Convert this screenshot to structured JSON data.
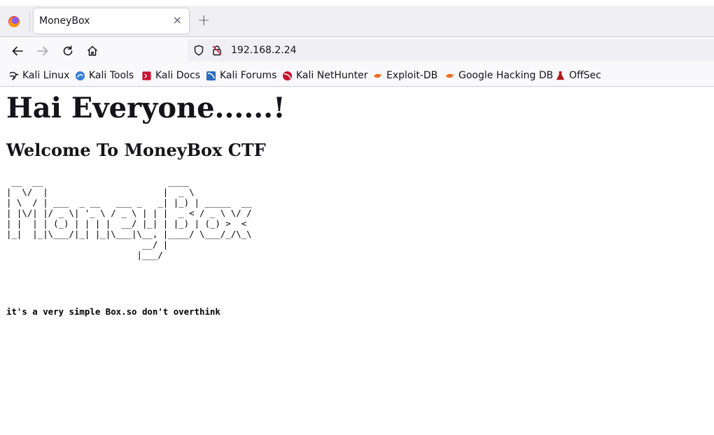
{
  "browser": {
    "tab_title": "MoneyBox",
    "tab_close": "×",
    "new_tab": "+",
    "url": "192.168.2.24"
  },
  "bookmarks": [
    {
      "label": "Kali Linux",
      "icon": "kali-dragon-icon"
    },
    {
      "label": "Kali Tools",
      "icon": "kali-tools-icon"
    },
    {
      "label": "Kali Docs",
      "icon": "kali-docs-icon"
    },
    {
      "label": "Kali Forums",
      "icon": "kali-forums-icon"
    },
    {
      "label": "Kali NetHunter",
      "icon": "kali-nethunter-icon"
    },
    {
      "label": "Exploit-DB",
      "icon": "exploit-db-icon"
    },
    {
      "label": "Google Hacking DB",
      "icon": "ghdb-icon"
    },
    {
      "label": "OffSec",
      "icon": "offsec-icon"
    }
  ],
  "page": {
    "heading": "Hai Everyone......!",
    "subheading": "Welcome To MoneyBox CTF",
    "ascii_art": " __  __                        ____\n|  \\/  |                      |  _ \\\n| \\  / | ___  _ __   ___ _   _| |_) | _____  __\n| |\\/| |/ _ \\| '_ \\ / _ \\ | | |  _ < / _ \\ \\/ /\n| |  | | (_) | | | |  __/ |_| | |_) | (_) >  <\n|_|  |_|\\___/|_| |_|\\___|\\__, |____/ \\___/_/\\_\\\n                          __/ |\n                         |___/",
    "note": "it's a very simple Box.so don't overthink"
  }
}
